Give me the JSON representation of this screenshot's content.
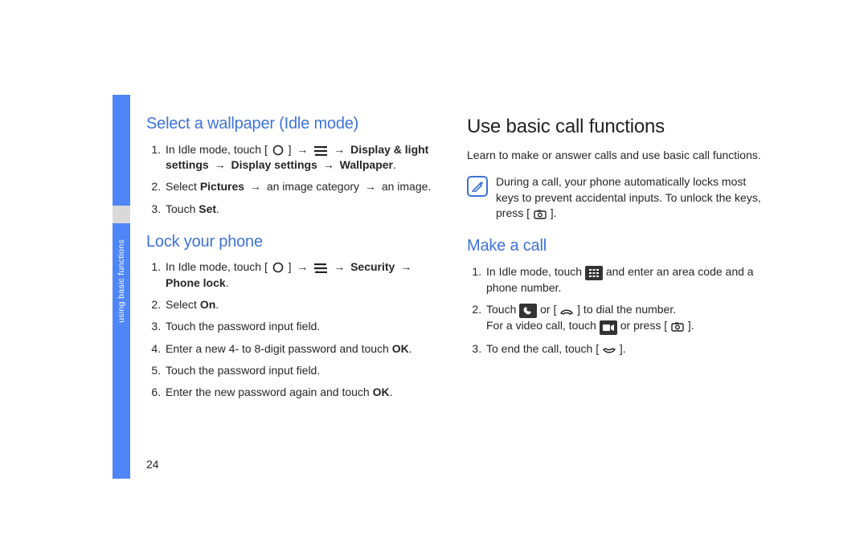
{
  "sidebar": {
    "label": "using basic functions"
  },
  "page_number": "24",
  "left": {
    "section1": {
      "title": "Select a wallpaper (Idle mode)",
      "steps": [
        {
          "pre": "In Idle mode, touch [",
          "hasCircle": true,
          "mid1": "] ",
          "hasArrow1": true,
          "mid2": " ",
          "hasMenu": true,
          "mid3": " ",
          "hasArrow2": true,
          "bold1": " Display & light settings ",
          "hasArrow3": true,
          "bold2": " Display settings ",
          "hasArrow4": true,
          "bold3": " Wallpaper",
          "end": "."
        },
        {
          "pre": "Select ",
          "bold1": "Pictures",
          "mid1": " ",
          "hasArrow1": true,
          "mid2": " an image category ",
          "hasArrow2": true,
          "end": " an image."
        },
        {
          "pre": "Touch ",
          "bold1": "Set",
          "end": "."
        }
      ]
    },
    "section2": {
      "title": "Lock your phone",
      "steps": [
        {
          "pre": "In Idle mode, touch [",
          "hasCircle": true,
          "mid1": "] ",
          "hasArrow1": true,
          "mid2": " ",
          "hasMenu": true,
          "mid3": " ",
          "hasArrow2": true,
          "bold1": " Security ",
          "hasArrow3": true,
          "bold2": " Phone lock",
          "end": "."
        },
        {
          "pre": "Select ",
          "bold1": "On",
          "end": "."
        },
        {
          "pre": "Touch the password input field."
        },
        {
          "pre": "Enter a new 4- to 8-digit password and touch ",
          "bold1": "OK",
          "end": "."
        },
        {
          "pre": "Touch the password input field."
        },
        {
          "pre": "Enter the new password again and touch ",
          "bold1": "OK",
          "end": "."
        }
      ]
    }
  },
  "right": {
    "h1": "Use basic call functions",
    "intro": "Learn to make or answer calls and use basic call functions.",
    "note": {
      "pre": "During a call, your phone automatically locks most keys to prevent accidental inputs. To unlock the keys, press [",
      "hasCamera": true,
      "end": "]."
    },
    "section1": {
      "title": "Make a call",
      "steps": [
        {
          "pre": "In Idle mode, touch ",
          "hasKeypad": true,
          "end": " and enter an area code and a phone number."
        },
        {
          "pre": "Touch ",
          "hasCallBox": true,
          "mid1": " or [",
          "hasCallKey": true,
          "mid2": "] to dial the number.",
          "br": true,
          "pre2": "For a video call, touch ",
          "hasVideoBox": true,
          "mid3": " or press [",
          "hasCamera": true,
          "end": "]."
        },
        {
          "pre": "To end the call, touch [",
          "hasEndKey": true,
          "end": "]."
        }
      ]
    }
  }
}
